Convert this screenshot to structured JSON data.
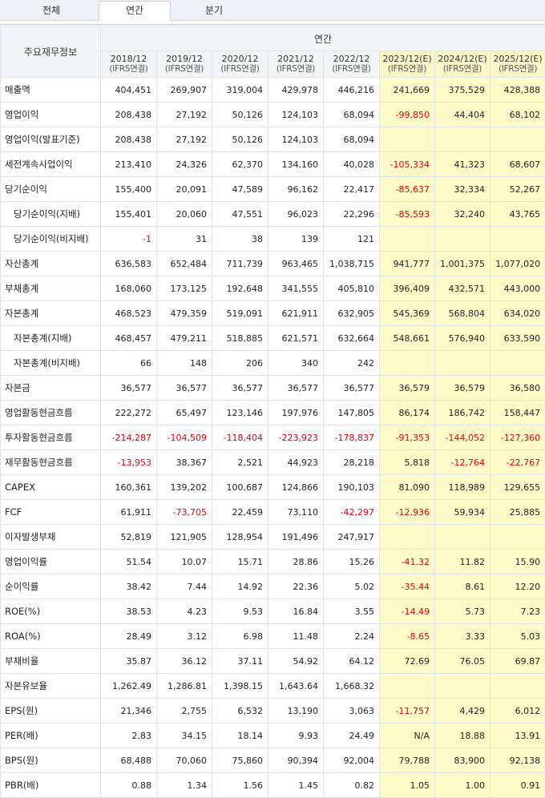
{
  "tabs": [
    "전체",
    "연간",
    "분기"
  ],
  "header": {
    "label_column": "주요재무정보",
    "period_group": "연간",
    "years": [
      "2018/12",
      "2019/12",
      "2020/12",
      "2021/12",
      "2022/12",
      "2023/12(E)",
      "2024/12(E)",
      "2025/12(E)"
    ],
    "basis": "(IFRS연결)"
  },
  "rows": [
    {
      "label": "매출액",
      "indent": false,
      "values": [
        "404,451",
        "269,907",
        "319,004",
        "429,978",
        "446,216",
        "241,669",
        "375,529",
        "428,388"
      ]
    },
    {
      "label": "영업이익",
      "indent": false,
      "values": [
        "208,438",
        "27,192",
        "50,126",
        "124,103",
        "68,094",
        "-99,850",
        "44,404",
        "68,102"
      ]
    },
    {
      "label": "영업이익(발표기준)",
      "indent": false,
      "values": [
        "208,438",
        "27,192",
        "50,126",
        "124,103",
        "68,094",
        "",
        "",
        ""
      ]
    },
    {
      "label": "세전계속사업이익",
      "indent": false,
      "values": [
        "213,410",
        "24,326",
        "62,370",
        "134,160",
        "40,028",
        "-105,334",
        "41,323",
        "68,607"
      ]
    },
    {
      "label": "당기순이익",
      "indent": false,
      "values": [
        "155,400",
        "20,091",
        "47,589",
        "96,162",
        "22,417",
        "-85,637",
        "32,334",
        "52,267"
      ]
    },
    {
      "label": "당기순이익(지배)",
      "indent": true,
      "values": [
        "155,401",
        "20,060",
        "47,551",
        "96,023",
        "22,296",
        "-85,593",
        "32,240",
        "43,765"
      ]
    },
    {
      "label": "당기순이익(비지배)",
      "indent": true,
      "values": [
        "-1",
        "31",
        "38",
        "139",
        "121",
        "",
        "",
        ""
      ]
    },
    {
      "label": "자산총계",
      "indent": false,
      "values": [
        "636,583",
        "652,484",
        "711,739",
        "963,465",
        "1,038,715",
        "941,777",
        "1,001,375",
        "1,077,020"
      ]
    },
    {
      "label": "부채총계",
      "indent": false,
      "values": [
        "168,060",
        "173,125",
        "192,648",
        "341,555",
        "405,810",
        "396,409",
        "432,571",
        "443,000"
      ]
    },
    {
      "label": "자본총계",
      "indent": false,
      "values": [
        "468,523",
        "479,359",
        "519,091",
        "621,911",
        "632,905",
        "545,369",
        "568,804",
        "634,020"
      ]
    },
    {
      "label": "자본총계(지배)",
      "indent": true,
      "values": [
        "468,457",
        "479,211",
        "518,885",
        "621,571",
        "632,664",
        "548,661",
        "576,940",
        "633,590"
      ]
    },
    {
      "label": "자본총계(비지배)",
      "indent": true,
      "values": [
        "66",
        "148",
        "206",
        "340",
        "242",
        "",
        "",
        ""
      ]
    },
    {
      "label": "자본금",
      "indent": false,
      "values": [
        "36,577",
        "36,577",
        "36,577",
        "36,577",
        "36,577",
        "36,579",
        "36,579",
        "36,580"
      ]
    },
    {
      "label": "영업활동현금흐름",
      "indent": false,
      "values": [
        "222,272",
        "65,497",
        "123,146",
        "197,976",
        "147,805",
        "86,174",
        "186,742",
        "158,447"
      ]
    },
    {
      "label": "투자활동현금흐름",
      "indent": false,
      "values": [
        "-214,287",
        "-104,509",
        "-118,404",
        "-223,923",
        "-178,837",
        "-91,353",
        "-144,052",
        "-127,360"
      ]
    },
    {
      "label": "재무활동현금흐름",
      "indent": false,
      "values": [
        "-13,953",
        "38,367",
        "2,521",
        "44,923",
        "28,218",
        "5,818",
        "-12,764",
        "-22,767"
      ]
    },
    {
      "label": "CAPEX",
      "indent": false,
      "values": [
        "160,361",
        "139,202",
        "100,687",
        "124,866",
        "190,103",
        "81,090",
        "118,989",
        "129,655"
      ]
    },
    {
      "label": "FCF",
      "indent": false,
      "values": [
        "61,911",
        "-73,705",
        "22,459",
        "73,110",
        "-42,297",
        "-12,936",
        "59,934",
        "25,885"
      ]
    },
    {
      "label": "이자발생부채",
      "indent": false,
      "values": [
        "52,819",
        "121,905",
        "128,954",
        "191,496",
        "247,917",
        "",
        "",
        ""
      ]
    },
    {
      "label": "영업이익률",
      "indent": false,
      "values": [
        "51.54",
        "10.07",
        "15.71",
        "28.86",
        "15.26",
        "-41.32",
        "11.82",
        "15.90"
      ]
    },
    {
      "label": "순이익률",
      "indent": false,
      "values": [
        "38.42",
        "7.44",
        "14.92",
        "22.36",
        "5.02",
        "-35.44",
        "8.61",
        "12.20"
      ]
    },
    {
      "label": "ROE(%)",
      "indent": false,
      "values": [
        "38.53",
        "4.23",
        "9.53",
        "16.84",
        "3.55",
        "-14.49",
        "5.73",
        "7.23"
      ]
    },
    {
      "label": "ROA(%)",
      "indent": false,
      "values": [
        "28.49",
        "3.12",
        "6.98",
        "11.48",
        "2.24",
        "-8.65",
        "3.33",
        "5.03"
      ]
    },
    {
      "label": "부채비율",
      "indent": false,
      "values": [
        "35.87",
        "36.12",
        "37.11",
        "54.92",
        "64.12",
        "72.69",
        "76.05",
        "69.87"
      ]
    },
    {
      "label": "자본유보율",
      "indent": false,
      "values": [
        "1,262.49",
        "1,286.81",
        "1,398.15",
        "1,643.64",
        "1,668.32",
        "",
        "",
        ""
      ]
    },
    {
      "label": "EPS(원)",
      "indent": false,
      "values": [
        "21,346",
        "2,755",
        "6,532",
        "13,190",
        "3,063",
        "-11,757",
        "4,429",
        "6,012"
      ]
    },
    {
      "label": "PER(배)",
      "indent": false,
      "values": [
        "2.83",
        "34.15",
        "18.14",
        "9.93",
        "24.49",
        "N/A",
        "18.88",
        "13.91"
      ]
    },
    {
      "label": "BPS(원)",
      "indent": false,
      "values": [
        "68,488",
        "70,060",
        "75,860",
        "90,394",
        "92,004",
        "79,788",
        "83,900",
        "92,138"
      ]
    },
    {
      "label": "PBR(배)",
      "indent": false,
      "values": [
        "0.88",
        "1.34",
        "1.56",
        "1.45",
        "0.82",
        "1.05",
        "1.00",
        "0.91"
      ]
    }
  ],
  "colors": {
    "negative": "#e8000b",
    "estimate_bg": "#fefbc9",
    "header_bg": "#f3f5f8"
  }
}
